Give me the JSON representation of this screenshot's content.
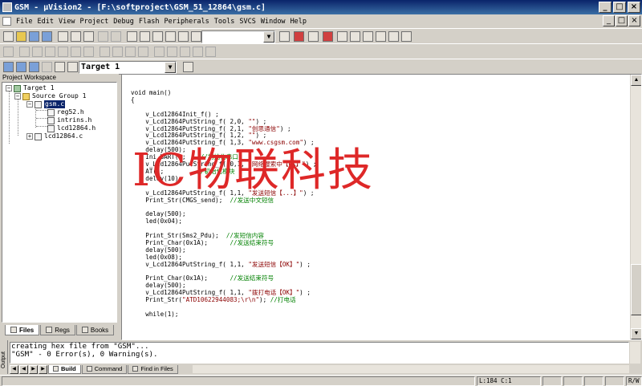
{
  "window": {
    "title": "GSM  - µVision2 - [F:\\softproject\\GSM_51_12864\\gsm.c]",
    "buttons": [
      "_",
      "□",
      "×"
    ]
  },
  "menu": {
    "items": [
      "File",
      "Edit",
      "View",
      "Project",
      "Debug",
      "Flash",
      "Peripherals",
      "Tools",
      "SVCS",
      "Window",
      "Help"
    ]
  },
  "toolbar3": {
    "target_label": "Target 1"
  },
  "workspace": {
    "title": "Project Workspace",
    "tree": [
      "Target 1",
      "Source Group 1",
      "gsm.c",
      "reg52.h",
      "intrins.h",
      "lcd12864.h",
      "lcd12864.c"
    ],
    "tabs": [
      "Files",
      "Regs",
      "Books"
    ]
  },
  "editor": {
    "lines": [
      [
        {
          "t": "void main()",
          "c": "kw"
        }
      ],
      [
        {
          "t": "{",
          "c": "kw"
        }
      ],
      [],
      [
        {
          "t": "    v_Lcd12864Init_f() ;",
          "c": "kw"
        }
      ],
      [
        {
          "t": "    v_Lcd12864PutString_f( 2,0, ",
          "c": "kw"
        },
        {
          "t": "\"\"",
          "c": "str"
        },
        {
          "t": ") ;",
          "c": "kw"
        }
      ],
      [
        {
          "t": "    v_Lcd12864PutString_f( 2,1, ",
          "c": "kw"
        },
        {
          "t": "\"创思通信\"",
          "c": "str"
        },
        {
          "t": ") ;",
          "c": "kw"
        }
      ],
      [
        {
          "t": "    v_Lcd12864PutString_f( 1,2, ",
          "c": "kw"
        },
        {
          "t": "\"\"",
          "c": "str"
        },
        {
          "t": ") ;",
          "c": "kw"
        }
      ],
      [
        {
          "t": "    v_Lcd12864PutString_f( 1,3, ",
          "c": "kw"
        },
        {
          "t": "\"www.csgsm.com\"",
          "c": "str"
        },
        {
          "t": ") ;",
          "c": "kw"
        }
      ],
      [
        {
          "t": "    delay(500);",
          "c": "kw"
        }
      ],
      [
        {
          "t": "    Ini_UART();",
          "c": "kw"
        },
        {
          "t": "    //初始化串口",
          "c": "cmt"
        }
      ],
      [
        {
          "t": "    v_Lcd12864PutString_f( 0,1, ",
          "c": "kw"
        },
        {
          "t": "\"网络搜索中【OK】\"",
          "c": "str"
        },
        {
          "t": ") ;",
          "c": "kw"
        }
      ],
      [
        {
          "t": "    AT();",
          "c": "kw"
        },
        {
          "t": "         //初始化模块",
          "c": "cmt"
        }
      ],
      [
        {
          "t": "    delay(10);",
          "c": "kw"
        }
      ],
      [],
      [
        {
          "t": "    v_Lcd12864PutString_f( 1,1, ",
          "c": "kw"
        },
        {
          "t": "\"发送短信【...】\"",
          "c": "str"
        },
        {
          "t": ") ;",
          "c": "kw"
        }
      ],
      [
        {
          "t": "    Print_Str(CMGS_send);",
          "c": "kw"
        },
        {
          "t": "  //发送中文短信",
          "c": "cmt"
        }
      ],
      [],
      [
        {
          "t": "    delay(500);",
          "c": "kw"
        }
      ],
      [
        {
          "t": "    led(0x04);",
          "c": "kw"
        }
      ],
      [],
      [
        {
          "t": "    Print_Str(Sms2_Pdu);",
          "c": "kw"
        },
        {
          "t": "  //发短信内容",
          "c": "cmt"
        }
      ],
      [
        {
          "t": "    Print_Char(0x1A);",
          "c": "kw"
        },
        {
          "t": "      //发送结束符号",
          "c": "cmt"
        }
      ],
      [
        {
          "t": "    delay(500);",
          "c": "kw"
        }
      ],
      [
        {
          "t": "    led(0x08);",
          "c": "kw"
        }
      ],
      [
        {
          "t": "    v_Lcd12864PutString_f( 1,1, ",
          "c": "kw"
        },
        {
          "t": "\"发送短信【OK】\"",
          "c": "str"
        },
        {
          "t": ") ;",
          "c": "kw"
        }
      ],
      [],
      [
        {
          "t": "    Print_Char(0x1A);",
          "c": "kw"
        },
        {
          "t": "      //发送结束符号",
          "c": "cmt"
        }
      ],
      [
        {
          "t": "    delay(500);",
          "c": "kw"
        }
      ],
      [
        {
          "t": "    v_Lcd12864PutString_f( 1,1, ",
          "c": "kw"
        },
        {
          "t": "\"拨打电话【OK】\"",
          "c": "str"
        },
        {
          "t": ") ;",
          "c": "kw"
        }
      ],
      [
        {
          "t": "    Print_Str(",
          "c": "kw"
        },
        {
          "t": "\"ATD10622944083;\\r\\n\"",
          "c": "str"
        },
        {
          "t": "); ",
          "c": "kw"
        },
        {
          "t": "//打电话",
          "c": "cmt"
        }
      ],
      [],
      [
        {
          "t": "    while(1);",
          "c": "kw"
        }
      ]
    ]
  },
  "watermark": {
    "text": "IC物联科技",
    "color": "#de2828"
  },
  "output": {
    "side_label": "Output",
    "lines": [
      "creating hex file from \"GSM\"...",
      "\"GSM\" - 0 Error(s), 0 Warning(s)."
    ],
    "tabs": [
      "Build",
      "Command",
      "Find in Files"
    ]
  },
  "status": {
    "position": "L:184 C:1",
    "mode": "R/W"
  }
}
